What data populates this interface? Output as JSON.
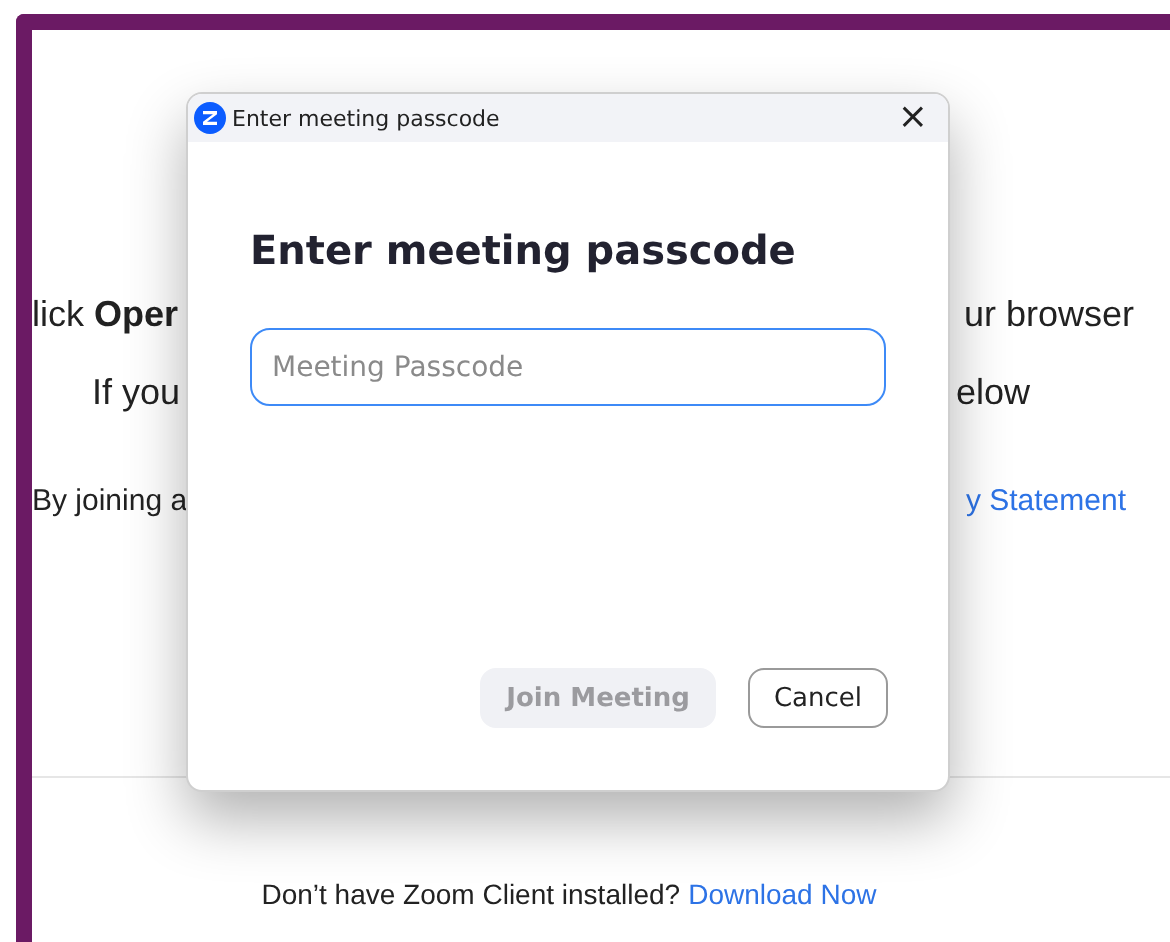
{
  "page": {
    "lines": [
      {
        "left": "lick **Oper**",
        "right": "ur browser",
        "kind": "large"
      },
      {
        "left": "If you",
        "right": "elow",
        "kind": "indent"
      },
      {
        "left": "By joining a",
        "right": "y Statement",
        "kind": "small"
      }
    ],
    "footer": {
      "text": "Don’t have Zoom Client installed?",
      "link": "Download Now"
    }
  },
  "dialog": {
    "title": "Enter meeting passcode",
    "heading": "Enter meeting passcode",
    "close": "×",
    "field": {
      "placeholder": "Meeting Passcode"
    },
    "buttons": [
      {
        "label": "Join Meeting",
        "disabled": true
      },
      {
        "label": "Cancel",
        "disabled": false
      }
    ]
  }
}
